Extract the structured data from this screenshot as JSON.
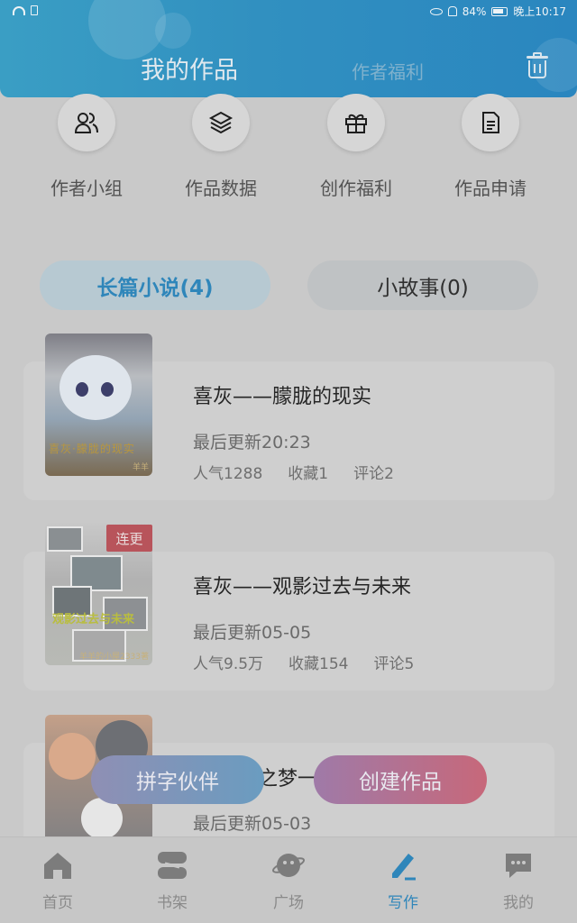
{
  "status_bar": {
    "battery": "84%",
    "time": "晚上10:17"
  },
  "header": {
    "title": "我的作品",
    "tab_welfare": "作者福利"
  },
  "quick_actions": [
    {
      "label": "作者小组",
      "icon": "group-icon"
    },
    {
      "label": "作品数据",
      "icon": "layers-icon"
    },
    {
      "label": "创作福利",
      "icon": "gift-icon"
    },
    {
      "label": "作品申请",
      "icon": "document-icon"
    }
  ],
  "segments": {
    "long": "长篇小说(4)",
    "short": "小故事(0)"
  },
  "works": [
    {
      "title": "喜灰——朦胧的现实",
      "updated": "最后更新20:23",
      "popularity": "人气1288",
      "favorites": "收藏1",
      "comments": "评论2",
      "cover_text": "喜灰·朦胧的现实",
      "cover_stamp": "羊羊"
    },
    {
      "badge": "连更",
      "title": "喜灰——观影过去与未来",
      "updated": "最后更新05-05",
      "popularity": "人气9.5万",
      "favorites": "收藏154",
      "comments": "评论5",
      "cover_text": "观影过去与未来",
      "cover_stamp": "羊羊的小屋2333著"
    },
    {
      "title": "之梦一",
      "updated": "最后更新05-03"
    }
  ],
  "floating_buttons": {
    "partner": "拼字伙伴",
    "create": "创建作品"
  },
  "bottom_nav": [
    {
      "label": "首页",
      "icon": "home-icon"
    },
    {
      "label": "书架",
      "icon": "bookshelf-icon"
    },
    {
      "label": "广场",
      "icon": "planet-icon"
    },
    {
      "label": "写作",
      "icon": "pen-icon"
    },
    {
      "label": "我的",
      "icon": "chat-icon"
    }
  ],
  "colors": {
    "accent": "#2f86ba",
    "header": "#3190c0",
    "badge": "#b8545b"
  }
}
